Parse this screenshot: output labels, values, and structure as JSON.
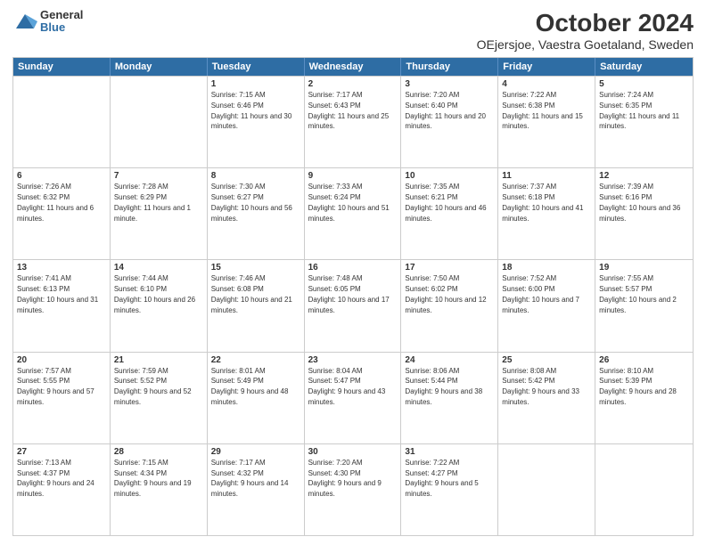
{
  "logo": {
    "general": "General",
    "blue": "Blue"
  },
  "title": "October 2024",
  "subtitle": "OEjersjoe, Vaestra Goetaland, Sweden",
  "header_days": [
    "Sunday",
    "Monday",
    "Tuesday",
    "Wednesday",
    "Thursday",
    "Friday",
    "Saturday"
  ],
  "weeks": [
    [
      {
        "day": "",
        "sunrise": "",
        "sunset": "",
        "daylight": ""
      },
      {
        "day": "",
        "sunrise": "",
        "sunset": "",
        "daylight": ""
      },
      {
        "day": "1",
        "sunrise": "Sunrise: 7:15 AM",
        "sunset": "Sunset: 6:46 PM",
        "daylight": "Daylight: 11 hours and 30 minutes."
      },
      {
        "day": "2",
        "sunrise": "Sunrise: 7:17 AM",
        "sunset": "Sunset: 6:43 PM",
        "daylight": "Daylight: 11 hours and 25 minutes."
      },
      {
        "day": "3",
        "sunrise": "Sunrise: 7:20 AM",
        "sunset": "Sunset: 6:40 PM",
        "daylight": "Daylight: 11 hours and 20 minutes."
      },
      {
        "day": "4",
        "sunrise": "Sunrise: 7:22 AM",
        "sunset": "Sunset: 6:38 PM",
        "daylight": "Daylight: 11 hours and 15 minutes."
      },
      {
        "day": "5",
        "sunrise": "Sunrise: 7:24 AM",
        "sunset": "Sunset: 6:35 PM",
        "daylight": "Daylight: 11 hours and 11 minutes."
      }
    ],
    [
      {
        "day": "6",
        "sunrise": "Sunrise: 7:26 AM",
        "sunset": "Sunset: 6:32 PM",
        "daylight": "Daylight: 11 hours and 6 minutes."
      },
      {
        "day": "7",
        "sunrise": "Sunrise: 7:28 AM",
        "sunset": "Sunset: 6:29 PM",
        "daylight": "Daylight: 11 hours and 1 minute."
      },
      {
        "day": "8",
        "sunrise": "Sunrise: 7:30 AM",
        "sunset": "Sunset: 6:27 PM",
        "daylight": "Daylight: 10 hours and 56 minutes."
      },
      {
        "day": "9",
        "sunrise": "Sunrise: 7:33 AM",
        "sunset": "Sunset: 6:24 PM",
        "daylight": "Daylight: 10 hours and 51 minutes."
      },
      {
        "day": "10",
        "sunrise": "Sunrise: 7:35 AM",
        "sunset": "Sunset: 6:21 PM",
        "daylight": "Daylight: 10 hours and 46 minutes."
      },
      {
        "day": "11",
        "sunrise": "Sunrise: 7:37 AM",
        "sunset": "Sunset: 6:18 PM",
        "daylight": "Daylight: 10 hours and 41 minutes."
      },
      {
        "day": "12",
        "sunrise": "Sunrise: 7:39 AM",
        "sunset": "Sunset: 6:16 PM",
        "daylight": "Daylight: 10 hours and 36 minutes."
      }
    ],
    [
      {
        "day": "13",
        "sunrise": "Sunrise: 7:41 AM",
        "sunset": "Sunset: 6:13 PM",
        "daylight": "Daylight: 10 hours and 31 minutes."
      },
      {
        "day": "14",
        "sunrise": "Sunrise: 7:44 AM",
        "sunset": "Sunset: 6:10 PM",
        "daylight": "Daylight: 10 hours and 26 minutes."
      },
      {
        "day": "15",
        "sunrise": "Sunrise: 7:46 AM",
        "sunset": "Sunset: 6:08 PM",
        "daylight": "Daylight: 10 hours and 21 minutes."
      },
      {
        "day": "16",
        "sunrise": "Sunrise: 7:48 AM",
        "sunset": "Sunset: 6:05 PM",
        "daylight": "Daylight: 10 hours and 17 minutes."
      },
      {
        "day": "17",
        "sunrise": "Sunrise: 7:50 AM",
        "sunset": "Sunset: 6:02 PM",
        "daylight": "Daylight: 10 hours and 12 minutes."
      },
      {
        "day": "18",
        "sunrise": "Sunrise: 7:52 AM",
        "sunset": "Sunset: 6:00 PM",
        "daylight": "Daylight: 10 hours and 7 minutes."
      },
      {
        "day": "19",
        "sunrise": "Sunrise: 7:55 AM",
        "sunset": "Sunset: 5:57 PM",
        "daylight": "Daylight: 10 hours and 2 minutes."
      }
    ],
    [
      {
        "day": "20",
        "sunrise": "Sunrise: 7:57 AM",
        "sunset": "Sunset: 5:55 PM",
        "daylight": "Daylight: 9 hours and 57 minutes."
      },
      {
        "day": "21",
        "sunrise": "Sunrise: 7:59 AM",
        "sunset": "Sunset: 5:52 PM",
        "daylight": "Daylight: 9 hours and 52 minutes."
      },
      {
        "day": "22",
        "sunrise": "Sunrise: 8:01 AM",
        "sunset": "Sunset: 5:49 PM",
        "daylight": "Daylight: 9 hours and 48 minutes."
      },
      {
        "day": "23",
        "sunrise": "Sunrise: 8:04 AM",
        "sunset": "Sunset: 5:47 PM",
        "daylight": "Daylight: 9 hours and 43 minutes."
      },
      {
        "day": "24",
        "sunrise": "Sunrise: 8:06 AM",
        "sunset": "Sunset: 5:44 PM",
        "daylight": "Daylight: 9 hours and 38 minutes."
      },
      {
        "day": "25",
        "sunrise": "Sunrise: 8:08 AM",
        "sunset": "Sunset: 5:42 PM",
        "daylight": "Daylight: 9 hours and 33 minutes."
      },
      {
        "day": "26",
        "sunrise": "Sunrise: 8:10 AM",
        "sunset": "Sunset: 5:39 PM",
        "daylight": "Daylight: 9 hours and 28 minutes."
      }
    ],
    [
      {
        "day": "27",
        "sunrise": "Sunrise: 7:13 AM",
        "sunset": "Sunset: 4:37 PM",
        "daylight": "Daylight: 9 hours and 24 minutes."
      },
      {
        "day": "28",
        "sunrise": "Sunrise: 7:15 AM",
        "sunset": "Sunset: 4:34 PM",
        "daylight": "Daylight: 9 hours and 19 minutes."
      },
      {
        "day": "29",
        "sunrise": "Sunrise: 7:17 AM",
        "sunset": "Sunset: 4:32 PM",
        "daylight": "Daylight: 9 hours and 14 minutes."
      },
      {
        "day": "30",
        "sunrise": "Sunrise: 7:20 AM",
        "sunset": "Sunset: 4:30 PM",
        "daylight": "Daylight: 9 hours and 9 minutes."
      },
      {
        "day": "31",
        "sunrise": "Sunrise: 7:22 AM",
        "sunset": "Sunset: 4:27 PM",
        "daylight": "Daylight: 9 hours and 5 minutes."
      },
      {
        "day": "",
        "sunrise": "",
        "sunset": "",
        "daylight": ""
      },
      {
        "day": "",
        "sunrise": "",
        "sunset": "",
        "daylight": ""
      }
    ]
  ]
}
